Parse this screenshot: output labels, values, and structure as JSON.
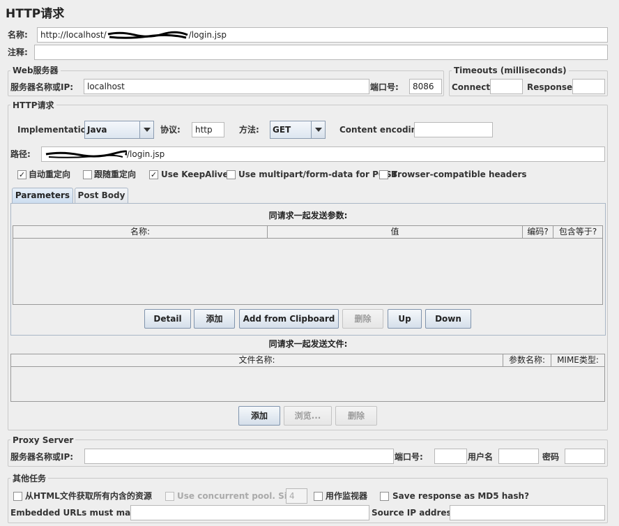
{
  "title": "HTTP请求",
  "name": {
    "label": "名称:",
    "value_prefix": "http://localhost/",
    "value_suffix": "/login.jsp"
  },
  "comment": {
    "label": "注释:",
    "value": ""
  },
  "web_server": {
    "legend": "Web服务器",
    "host_label": "服务器名称或IP:",
    "host_value": "localhost",
    "port_label": "端口号:",
    "port_value": "8086"
  },
  "timeouts": {
    "legend": "Timeouts (milliseconds)",
    "connect_label": "Connect:",
    "connect_value": "",
    "response_label": "Response:",
    "response_value": ""
  },
  "http_request": {
    "legend": "HTTP请求",
    "implementation_label": "Implementation:",
    "implementation_value": "Java",
    "protocol_label": "协议:",
    "protocol_value": "http",
    "method_label": "方法:",
    "method_value": "GET",
    "encoding_label": "Content encoding:",
    "encoding_value": "",
    "path_label": "路径:",
    "path_suffix": "/login.jsp",
    "checkboxes": [
      {
        "label": "自动重定向",
        "checked": true
      },
      {
        "label": "跟随重定向",
        "checked": false
      },
      {
        "label": "Use KeepAlive",
        "checked": true
      },
      {
        "label": "Use multipart/form-data for POST",
        "checked": false
      },
      {
        "label": "Browser-compatible headers",
        "checked": false
      }
    ],
    "tabs": [
      "Parameters",
      "Post Body"
    ],
    "params_title": "同请求一起发送参数:",
    "params_columns": [
      "名称:",
      "值",
      "编码?",
      "包含等于?"
    ],
    "params_buttons": [
      "Detail",
      "添加",
      "Add from Clipboard",
      "删除",
      "Up",
      "Down"
    ],
    "files_title": "同请求一起发送文件:",
    "files_columns": [
      "文件名称:",
      "参数名称:",
      "MIME类型:"
    ],
    "files_buttons": [
      "添加",
      "浏览...",
      "删除"
    ]
  },
  "proxy": {
    "legend": "Proxy Server",
    "host_label": "服务器名称或IP:",
    "host_value": "",
    "port_label": "端口号:",
    "port_value": "",
    "user_label": "用户名",
    "user_value": "",
    "password_label": "密码",
    "password_value": ""
  },
  "other": {
    "legend": "其他任务",
    "retrieve_label": "从HTML文件获取所有内含的资源",
    "pool_label": "Use concurrent pool. Size:",
    "pool_value": "4",
    "monitor_label": "用作监视器",
    "md5_label": "Save response as MD5 hash?",
    "embedded_label": "Embedded URLs must match:",
    "embedded_value": "",
    "source_ip_label": "Source IP address:",
    "source_ip_value": ""
  }
}
